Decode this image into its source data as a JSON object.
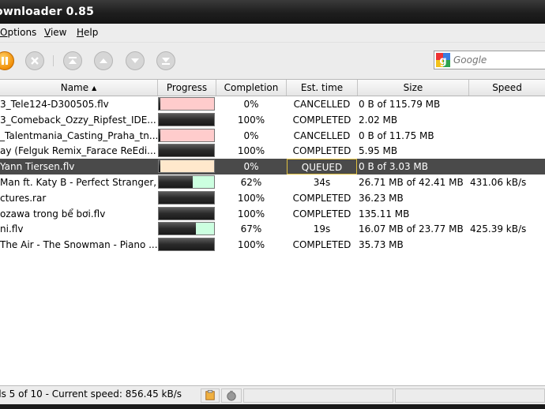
{
  "window": {
    "title": "ownloader 0.85"
  },
  "menu": [
    {
      "label": "Options",
      "accel": "O",
      "rest": "ptions"
    },
    {
      "label": "View",
      "accel": "V",
      "rest": "iew"
    },
    {
      "label": "Help",
      "accel": "H",
      "rest": "elp"
    }
  ],
  "toolbar": {
    "icons": [
      "pause-icon",
      "cancel-icon",
      "move-top-icon",
      "move-up-icon",
      "move-down-icon",
      "move-bottom-icon"
    ],
    "search": {
      "placeholder": "Google"
    }
  },
  "columns": {
    "name": "Name",
    "progress": "Progress",
    "completion": "Completion",
    "est_time": "Est. time",
    "size": "Size",
    "speed": "Speed"
  },
  "rows": [
    {
      "name": "3_Tele124-D300505.flv",
      "progress": 0.0,
      "progress_color": "#ffcccc",
      "completion": "0%",
      "est_time": "CANCELLED",
      "size": "0 B of 115.79 MB",
      "speed": ""
    },
    {
      "name": "3_Comeback_Ozzy_Ripfest_IDE...",
      "progress": 1.0,
      "progress_color": "#ffffff",
      "completion": "100%",
      "est_time": "COMPLETED",
      "size": "2.02 MB",
      "speed": ""
    },
    {
      "name": "_Talentmania_Casting_Praha_tn...",
      "progress": 0.0,
      "progress_color": "#ffcccc",
      "completion": "0%",
      "est_time": "CANCELLED",
      "size": "0 B of 11.75 MB",
      "speed": ""
    },
    {
      "name": "ay (Felguk Remix_Farace ReEdi...",
      "progress": 1.0,
      "progress_color": "#ffffff",
      "completion": "100%",
      "est_time": "COMPLETED",
      "size": "5.95 MB",
      "speed": ""
    },
    {
      "name": "Yann Tiersen.flv",
      "progress": 0.0,
      "progress_color": "#ffe8cc",
      "completion": "0%",
      "est_time": "QUEUED",
      "size": "0 B of 3.03 MB",
      "speed": "",
      "selected": true
    },
    {
      "name": "Man ft. Katy B - Perfect Stranger,...",
      "progress": 0.62,
      "progress_color": "#ccffe0",
      "completion": "62%",
      "est_time": "34s",
      "size": "26.71 MB of 42.41 MB",
      "speed": "431.06 kB/s"
    },
    {
      "name": "ctures.rar",
      "progress": 1.0,
      "progress_color": "#ffffff",
      "completion": "100%",
      "est_time": "COMPLETED",
      "size": "36.23 MB",
      "speed": ""
    },
    {
      "name": " ozawa trong bể bơi.flv",
      "progress": 1.0,
      "progress_color": "#ffffff",
      "completion": "100%",
      "est_time": "COMPLETED",
      "size": "135.11 MB",
      "speed": ""
    },
    {
      "name": "ni.flv",
      "progress": 0.67,
      "progress_color": "#ccffe0",
      "completion": "67%",
      "est_time": "19s",
      "size": "16.07 MB of 23.77 MB",
      "speed": "425.39 kB/s"
    },
    {
      "name": " The Air - The Snowman - Piano ...",
      "progress": 1.0,
      "progress_color": "#ffffff",
      "completion": "100%",
      "est_time": "COMPLETED",
      "size": "35.73 MB",
      "speed": ""
    }
  ],
  "status": {
    "text": "ds 5 of 10 - Current speed: 856.45 kB/s",
    "icons": [
      "clipboard-monitor-icon",
      "scheduler-icon"
    ]
  }
}
